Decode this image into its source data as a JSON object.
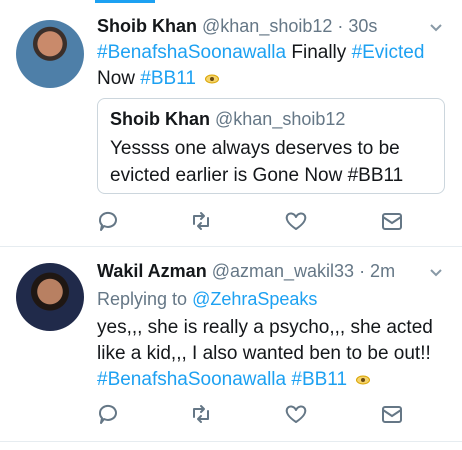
{
  "tweets": [
    {
      "name": "Shoib Khan",
      "handle": "@khan_shoib12",
      "time": "· 30s",
      "text": {
        "tag1": "#BenafshaSoonawalla",
        "mid": " Finally ",
        "tag2": "#Evicted",
        "line2": "Now ",
        "tag3": "#BB11"
      },
      "quote": {
        "name": "Shoib Khan",
        "handle": "@khan_shoib12",
        "text": "Yessss one always deserves to be evicted earlier is Gone Now #BB11"
      }
    },
    {
      "name": "Wakil Azman",
      "handle": "@azman_wakil33",
      "time": "· 2m",
      "replying_label": "Replying to ",
      "replying_to": "@ZehraSpeaks",
      "text": {
        "line1": "yes,,, she is really a psycho,,, she acted",
        "line2": "like a kid,,, I also wanted ben to be out!!",
        "tag1": "#BenafshaSoonawalla",
        "tag2": "#BB11"
      }
    }
  ],
  "icons": [
    "reply-icon",
    "retweet-icon",
    "like-icon",
    "direct-message-icon",
    "chevron-down-icon",
    "eye-emoji-icon"
  ],
  "colors": {
    "link": "#1da1f2",
    "secondary": "#657786",
    "border": "#e6ecf0"
  }
}
